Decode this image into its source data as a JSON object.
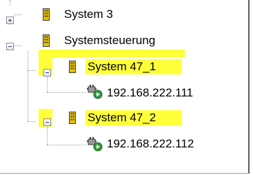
{
  "tree": {
    "items": [
      {
        "label": "System 3",
        "expander": "+",
        "icon": "system-icon",
        "highlighted": false
      },
      {
        "label": "Systemsteuerung",
        "expander": "-",
        "icon": "system-icon",
        "highlighted": false,
        "underline_highlight": true
      },
      {
        "label": "System 47_1",
        "expander": "-",
        "icon": "system-icon",
        "highlighted": true
      },
      {
        "label": "192.168.222.111",
        "icon": "network-device-icon",
        "highlighted": false
      },
      {
        "label": "System 47_2",
        "expander": "-",
        "icon": "system-icon",
        "highlighted": true
      },
      {
        "label": "192.168.222.112",
        "icon": "network-device-icon",
        "highlighted": false
      }
    ]
  },
  "colors": {
    "highlight": "#ffff3a",
    "icon_yellow": "#e6c200",
    "icon_dark": "#3a3a3a",
    "play_green": "#2e9e3a"
  }
}
